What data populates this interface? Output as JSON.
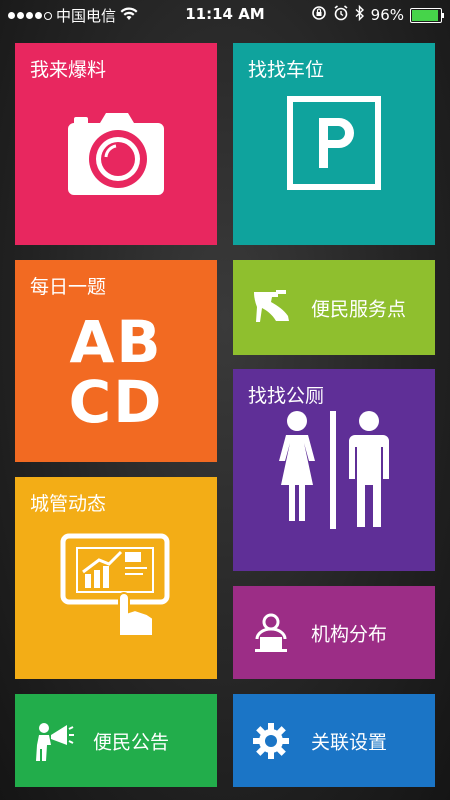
{
  "status_bar": {
    "carrier": "中国电信",
    "time": "11:14 AM",
    "battery": "96%"
  },
  "tiles": {
    "baoliao": {
      "label": "我来爆料",
      "icon": "camera-icon"
    },
    "chewei": {
      "label": "找找车位",
      "icon": "parking-icon"
    },
    "meiri": {
      "label": "每日一题",
      "glyph_top": "AB",
      "glyph_bottom": "CD"
    },
    "bianmin_service": {
      "label": "便民服务点",
      "icon": "high-heel-icon"
    },
    "gongce": {
      "label": "找找公厕",
      "icon": "restroom-icon"
    },
    "chengguan": {
      "label": "城管动态",
      "icon": "tablet-chart-icon"
    },
    "jigou": {
      "label": "机构分布",
      "icon": "person-desk-icon"
    },
    "gonggao": {
      "label": "便民公告",
      "icon": "megaphone-icon"
    },
    "shezhi": {
      "label": "关联设置",
      "icon": "gear-icon"
    }
  },
  "colors": {
    "baoliao": "#e8275f",
    "chewei": "#0fa39d",
    "meiri": "#f26a22",
    "bianmin_service": "#8fbf2e",
    "gongce": "#5f2f97",
    "chengguan": "#f3ad16",
    "jigou": "#9c2d86",
    "gonggao": "#22ad4b",
    "shezhi": "#1b75c6"
  }
}
